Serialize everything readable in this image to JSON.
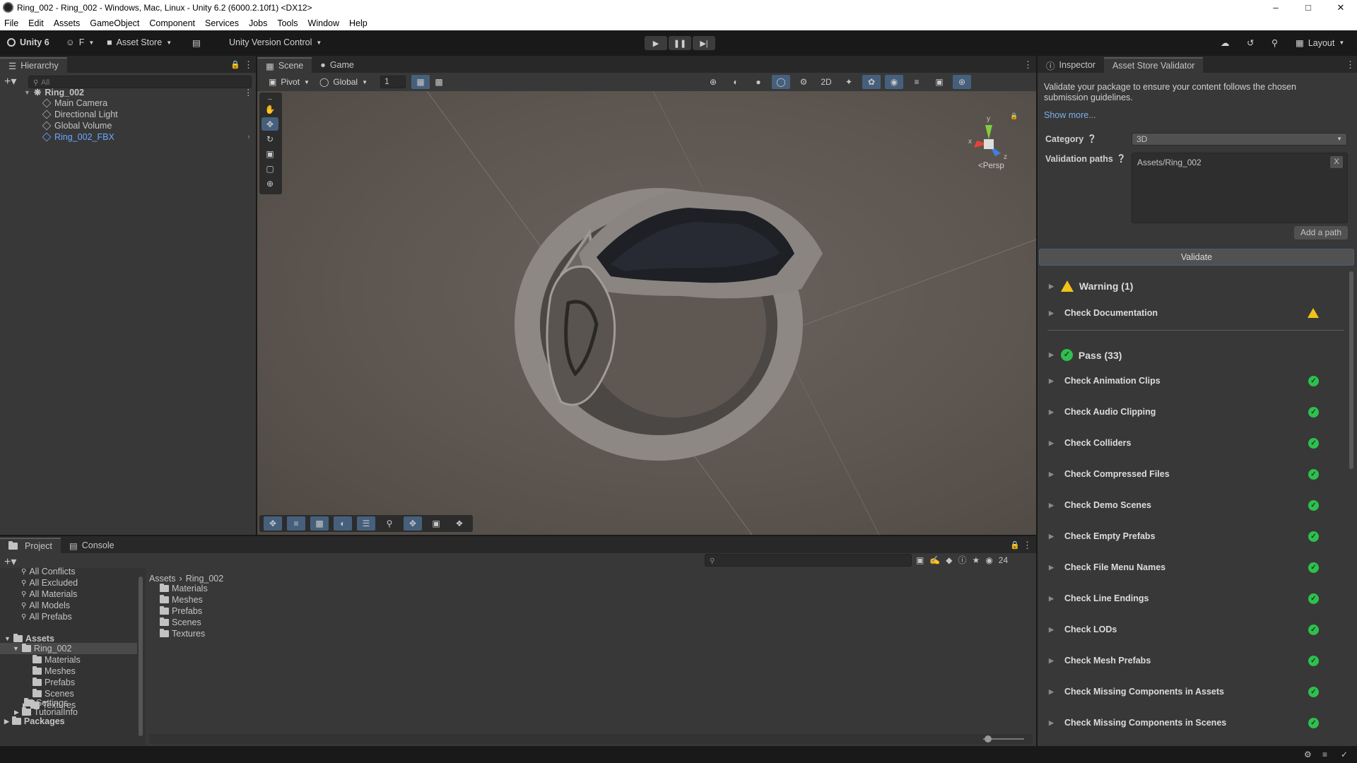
{
  "window": {
    "title": "Ring_002 - Ring_002 - Windows, Mac, Linux - Unity 6.2 (6000.2.10f1) <DX12>"
  },
  "menu": [
    "File",
    "Edit",
    "Assets",
    "GameObject",
    "Component",
    "Services",
    "Jobs",
    "Tools",
    "Window",
    "Help"
  ],
  "toolbar": {
    "unity": "Unity 6",
    "account": "F",
    "asset_store": "Asset Store",
    "version_control": "Unity Version Control",
    "layout": "Layout"
  },
  "hierarchy": {
    "tab": "Hierarchy",
    "search_placeholder": "All",
    "scene": "Ring_002",
    "items": [
      "Main Camera",
      "Directional Light",
      "Global Volume",
      "Ring_002_FBX"
    ]
  },
  "scene_view": {
    "tabs": [
      "Scene",
      "Game"
    ],
    "pivot": "Pivot",
    "global": "Global",
    "snap_value": "1",
    "gizmo_label": "Persp",
    "axis_x": "x",
    "axis_y": "y",
    "axis_z": "z"
  },
  "project": {
    "tabs": [
      "Project",
      "Console"
    ],
    "favorites": [
      "All Conflicts",
      "All Excluded",
      "All Materials",
      "All Models",
      "All Prefabs"
    ],
    "tree_assets": "Assets",
    "tree_ring": "Ring_002",
    "tree_ring_children": [
      "Materials",
      "Meshes",
      "Prefabs",
      "Scenes",
      "Textures"
    ],
    "tree_settings": "Settings",
    "tree_tutorial": "TutorialInfo",
    "tree_packages": "Packages",
    "breadcrumb": [
      "Assets",
      "Ring_002"
    ],
    "folders": [
      "Materials",
      "Meshes",
      "Prefabs",
      "Scenes",
      "Textures"
    ],
    "hidden_count": "24"
  },
  "inspector": {
    "tabs": [
      "Inspector",
      "Asset Store Validator"
    ],
    "description": "Validate your package to ensure your content follows the chosen submission guidelines.",
    "show_more": "Show more...",
    "category_label": "Category",
    "category_value": "3D",
    "paths_label": "Validation paths",
    "path_value": "Assets/Ring_002",
    "remove_path": "X",
    "add_path": "Add a path",
    "validate": "Validate",
    "warning_header": "Warning (1)",
    "warnings": [
      "Check Documentation"
    ],
    "pass_header": "Pass (33)",
    "passes": [
      "Check Animation Clips",
      "Check Audio Clipping",
      "Check Colliders",
      "Check Compressed Files",
      "Check Demo Scenes",
      "Check Empty Prefabs",
      "Check File Menu Names",
      "Check Line Endings",
      "Check LODs",
      "Check Mesh Prefabs",
      "Check Missing Components in Assets",
      "Check Missing Components in Scenes"
    ]
  },
  "colors": {
    "accent": "#46607c",
    "pass": "#2fbf4e",
    "warning": "#f2c21a",
    "link": "#7ab1e8"
  }
}
